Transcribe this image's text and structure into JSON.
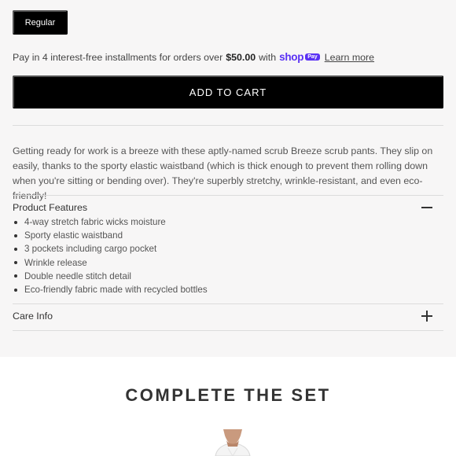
{
  "variant": {
    "selected_label": "Regular"
  },
  "payment": {
    "prefix": "Pay in 4 interest-free installments for orders over",
    "amount": "$50.00",
    "middle": "with",
    "brand": "shop",
    "pay_badge": "Pay",
    "learn_more": "Learn more",
    "brand_color": "#5a31f4"
  },
  "cart": {
    "add_label": "ADD TO CART"
  },
  "description": "Getting ready for work is a breeze with these aptly-named scrub Breeze scrub pants. They slip on easily, thanks to the sporty elastic waistband (which is thick enough to prevent them rolling down when you're sitting or bending over). They're superbly stretchy, wrinkle-resistant, and even eco-friendly!",
  "accordion": {
    "features_title": "Product Features",
    "features_icon": "minus-icon",
    "features": [
      "4-way stretch fabric wicks moisture",
      "Sporty elastic waistband",
      "3 pockets including cargo pocket",
      "Wrinkle release",
      "Double needle stitch detail",
      "Eco-friendly fabric made with recycled bottles"
    ],
    "care_title": "Care Info",
    "care_icon": "plus-icon"
  },
  "related": {
    "title": "COMPLETE THE SET"
  }
}
